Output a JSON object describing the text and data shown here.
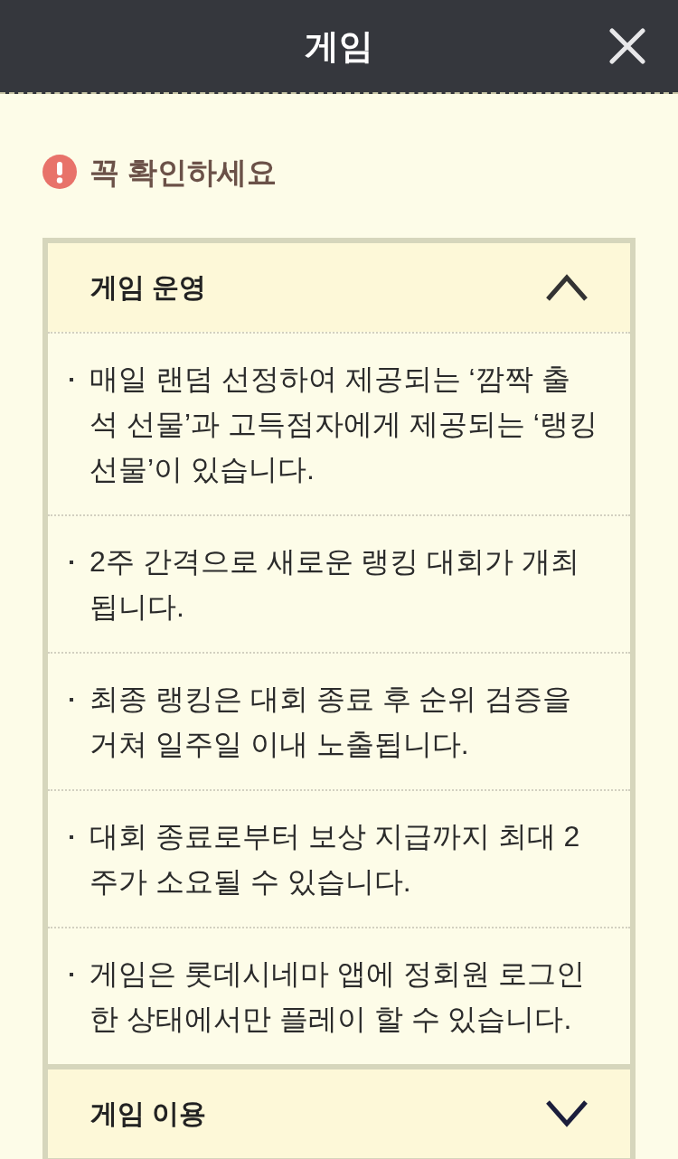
{
  "header": {
    "title": "게임"
  },
  "notice": {
    "title": "꼭 확인하세요"
  },
  "sections": [
    {
      "title": "게임 운영",
      "expanded": true,
      "items": [
        "매일 랜덤 선정하여 제공되는 ‘깜짝 출석 선물’과 고득점자에게 제공되는 ‘랭킹 선물’이 있습니다.",
        "2주 간격으로 새로운 랭킹 대회가 개최됩니다.",
        "최종 랭킹은 대회 종료 후 순위 검증을 거쳐 일주일 이내 노출됩니다.",
        "대회 종료로부터 보상 지급까지 최대 2주가 소요될 수 있습니다.",
        "게임은 롯데시네마 앱에 정회원 로그인 한 상태에서만 플레이 할 수 있습니다."
      ]
    },
    {
      "title": "게임 이용",
      "expanded": false
    }
  ]
}
